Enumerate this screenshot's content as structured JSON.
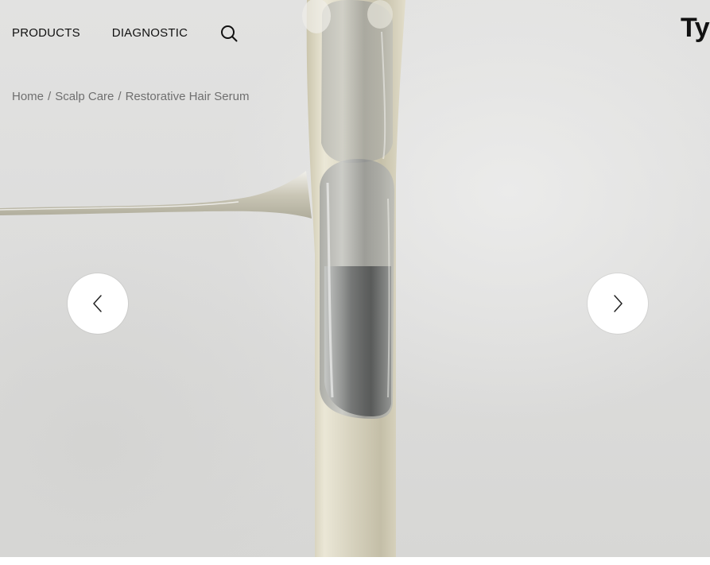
{
  "nav": {
    "items": [
      {
        "label": "PRODUCTS"
      },
      {
        "label": "DIAGNOSTIC"
      }
    ],
    "search_icon": "search-icon"
  },
  "brand": {
    "logo_text": "Typ"
  },
  "breadcrumb": {
    "items": [
      {
        "label": "Home"
      },
      {
        "label": "Scalp Care"
      },
      {
        "label": "Restorative Hair Serum"
      }
    ],
    "separator": "/"
  },
  "carousel": {
    "image_description_icon": "serum-dropper-image",
    "prev_icon": "chevron-left-icon",
    "next_icon": "chevron-right-icon"
  },
  "colors": {
    "text": "#111111",
    "breadcrumb_text": "#6f6f6f",
    "button_bg": "#ffffff",
    "hero_bg": "#dedede"
  }
}
